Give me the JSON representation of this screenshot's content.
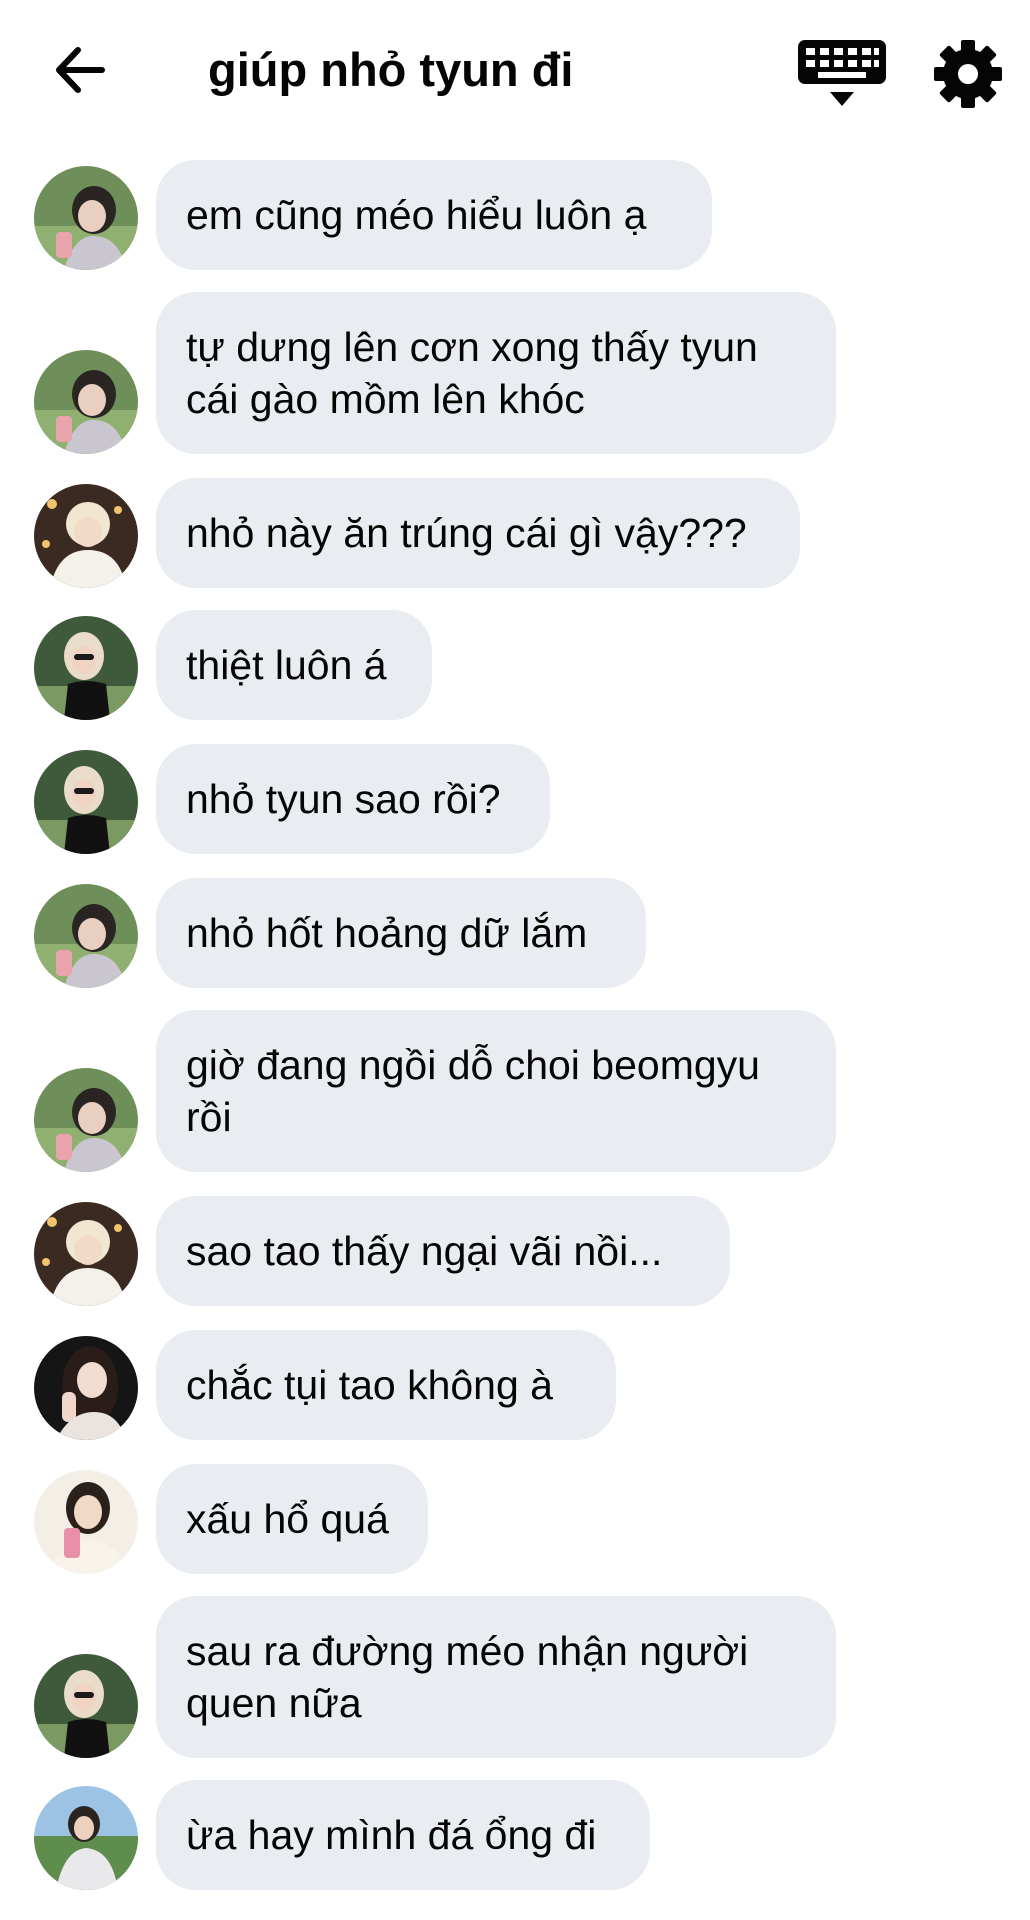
{
  "header": {
    "title": "giúp nhỏ tyun đi",
    "back_icon": "arrow-left-icon",
    "keyboard_icon": "keyboard-icon",
    "settings_icon": "gear-icon"
  },
  "colors": {
    "bubble_bg": "#e9ecf0",
    "text": "#050505",
    "background": "#ffffff"
  },
  "messages": [
    {
      "avatar": "avatar-boy-dark-hair",
      "lines": [
        "em cũng méo hiểu luôn ạ"
      ]
    },
    {
      "avatar": "avatar-boy-dark-hair",
      "lines": [
        "tự dưng lên cơn xong thấy tyun",
        "cái gào mồm lên khóc"
      ]
    },
    {
      "avatar": "avatar-blonde-white-sweater",
      "lines": [
        "nhỏ này ăn trúng cái gì vậy???"
      ]
    },
    {
      "avatar": "avatar-girl-black-top",
      "lines": [
        "thiệt luôn á"
      ]
    },
    {
      "avatar": "avatar-girl-black-top",
      "lines": [
        "nhỏ tyun sao rồi?"
      ]
    },
    {
      "avatar": "avatar-boy-dark-hair",
      "lines": [
        "nhỏ hốt hoảng dữ lắm"
      ]
    },
    {
      "avatar": "avatar-boy-dark-hair",
      "lines": [
        "giờ đang ngồi dỗ choi beomgyu",
        "rồi"
      ]
    },
    {
      "avatar": "avatar-blonde-white-sweater",
      "lines": [
        "sao tao thấy ngại vãi nồi..."
      ]
    },
    {
      "avatar": "avatar-girl-long-dark-hair",
      "lines": [
        "chắc tụi tao không à"
      ]
    },
    {
      "avatar": "avatar-girl-pink-drink",
      "lines": [
        "xấu hổ quá"
      ]
    },
    {
      "avatar": "avatar-girl-black-top",
      "lines": [
        "sau ra đường méo nhận người",
        "quen nữa"
      ]
    },
    {
      "avatar": "avatar-boy-outdoor",
      "lines": [
        "ừa hay mình đá ổng đi"
      ]
    }
  ]
}
